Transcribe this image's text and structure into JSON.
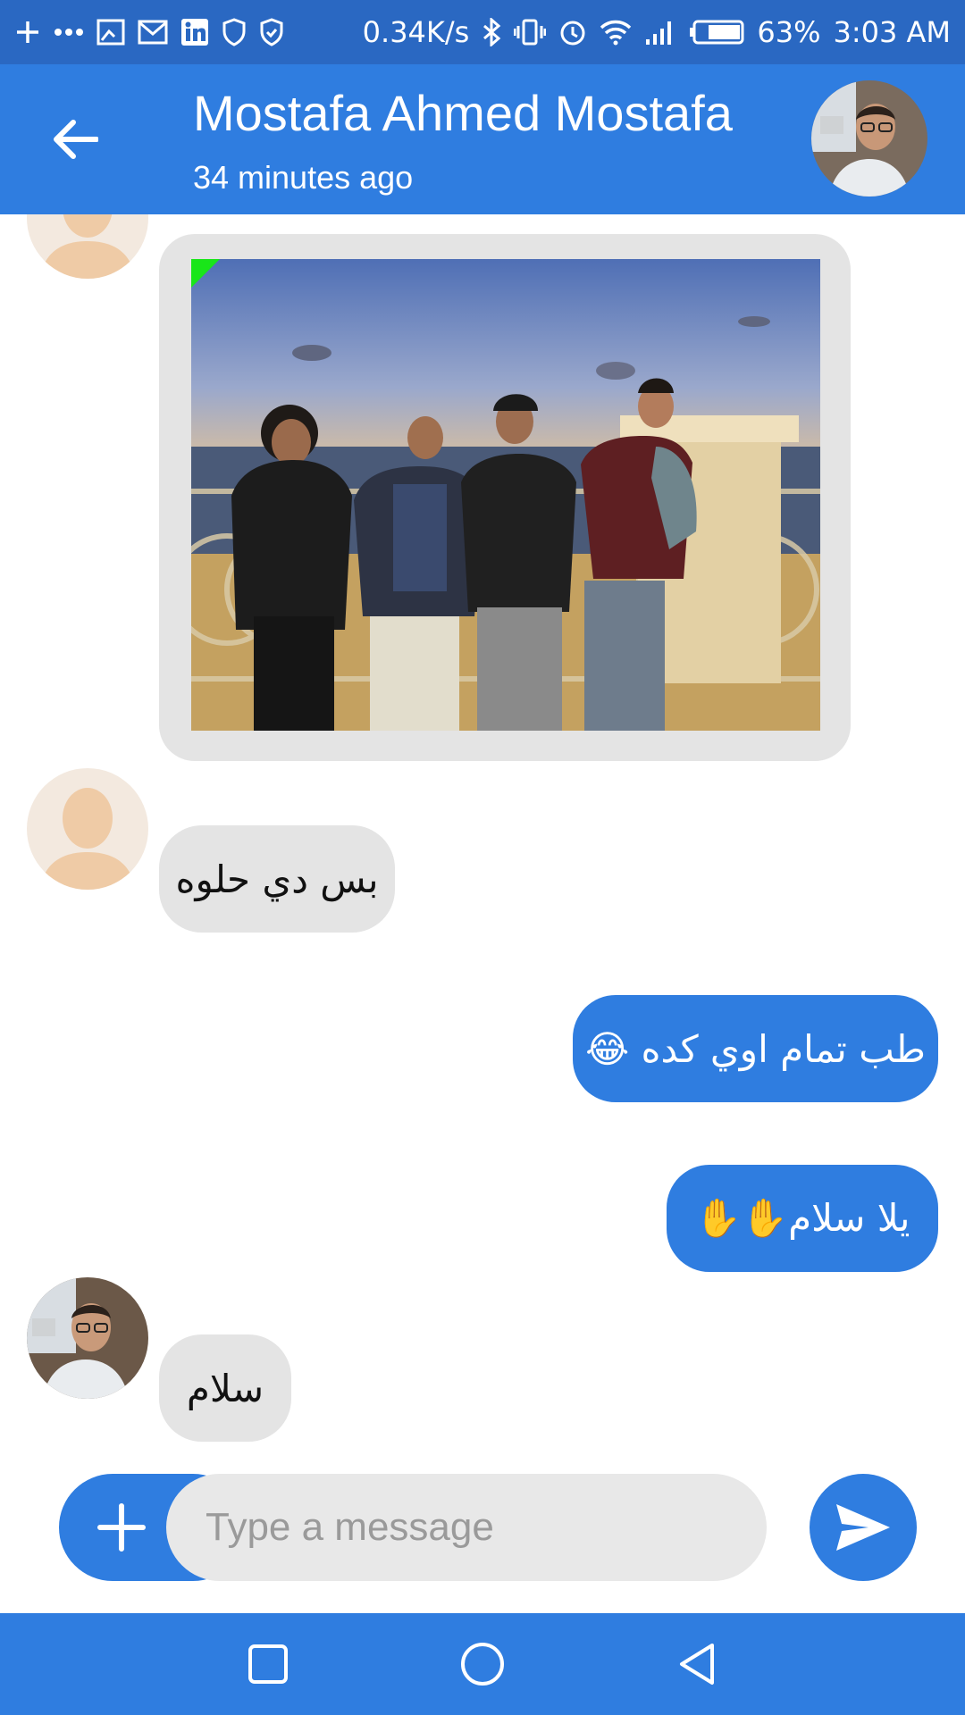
{
  "status_bar": {
    "net_speed": "0.34K/s",
    "battery": "63%",
    "time": "3:03 AM",
    "icons": [
      "plus-icon",
      "more-dots-icon",
      "cast-icon",
      "gmail-icon",
      "linkedin-icon",
      "shield-icon",
      "shield-check-icon",
      "bluetooth-icon",
      "vibrate-icon",
      "alarm-icon",
      "wifi-icon",
      "signal-icon",
      "battery-icon"
    ]
  },
  "header": {
    "contact_name": "Mostafa Ahmed Mostafa",
    "last_seen": "34 minutes ago"
  },
  "messages": [
    {
      "from": "contact",
      "type": "image"
    },
    {
      "from": "contact",
      "type": "text",
      "text": "بس دي حلوه"
    },
    {
      "from": "me",
      "type": "text",
      "text": "طب تمام اوي كده 😂"
    },
    {
      "from": "me",
      "type": "text",
      "text": "يلا سلام✋✋"
    },
    {
      "from": "contact",
      "type": "text",
      "text": "سلام"
    }
  ],
  "composer": {
    "placeholder": "Type a message"
  },
  "colors": {
    "primary": "#2f7de0",
    "status_bar": "#2a68c2",
    "incoming_bubble": "#e4e4e4",
    "outgoing_bubble": "#2f7de0"
  }
}
